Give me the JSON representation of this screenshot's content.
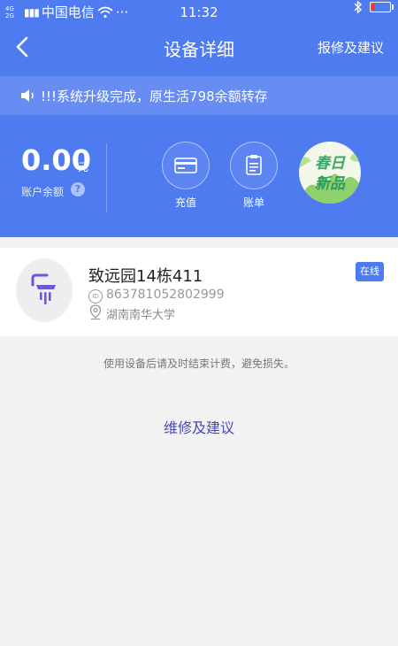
{
  "status_bar": {
    "network": "4G 2G",
    "carrier": "中国电信",
    "more": "···",
    "time": "11:32"
  },
  "nav": {
    "title": "设备详细",
    "right_action": "报修及建议"
  },
  "notice": {
    "text": "!!!系统升级完成，原生活798余额转存"
  },
  "account": {
    "balance": "0.00",
    "unit": "元",
    "label": "账户余额",
    "help": "?"
  },
  "actions": {
    "recharge": "充值",
    "bill": "账单"
  },
  "promo": {
    "line1": "春日",
    "line2": "新品"
  },
  "device": {
    "name": "致远园14栋411",
    "id_badge": "ID",
    "id": "863781052802999",
    "location": "湖南南华大学",
    "status": "在线"
  },
  "tip": "使用设备后请及时结束计费，避免损失。",
  "repair_link": "维修及建议",
  "colors": {
    "primary": "#4f7bf0",
    "link": "#4a48b8",
    "background": "#f2f2f2"
  }
}
